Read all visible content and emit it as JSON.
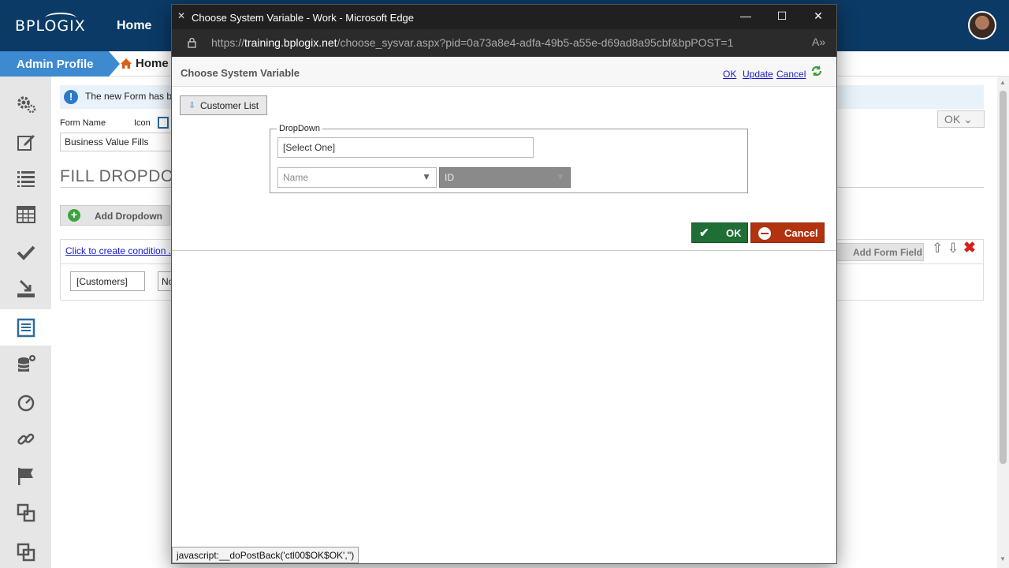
{
  "app": {
    "logo": "BPLOGIX",
    "top_nav": {
      "home": "Home"
    },
    "breadcrumb": {
      "admin": "Admin Profile",
      "home": "Home"
    },
    "info_message": "The new Form has b",
    "ok_dropdown": "OK",
    "form_name_label": "Form Name",
    "icon_label": "Icon",
    "form_name_value": "Business Value Fills",
    "heading": "FILL DROPDOW",
    "add_dropdown": "Add Dropdown",
    "condition_link": "Click to create condition ...",
    "customers_value": "[Customers]",
    "no_value": "No",
    "add_form_field": "Add Form Field"
  },
  "sidebar": {
    "items": [
      {
        "icon": "gears-icon"
      },
      {
        "icon": "edit-icon"
      },
      {
        "icon": "list-icon"
      },
      {
        "icon": "table-icon"
      },
      {
        "icon": "check-icon"
      },
      {
        "icon": "install-icon"
      },
      {
        "icon": "form-list-icon",
        "active": true
      },
      {
        "icon": "database-add-icon"
      },
      {
        "icon": "speedometer-icon"
      },
      {
        "icon": "link-icon"
      },
      {
        "icon": "flag-icon"
      },
      {
        "icon": "copy-icon"
      },
      {
        "icon": "stack-icon"
      }
    ]
  },
  "popup": {
    "window_title": "Choose System Variable - Work - Microsoft Edge",
    "url_prefix": "https://",
    "url_host": "training.bplogix.net",
    "url_path": "/choose_sysvar.aspx?pid=0a73a8e4-adfa-49b5-a55e-d69ad8a95cbf&bpPOST=1",
    "dialog_title": "Choose System Variable",
    "header_links": {
      "ok": "OK",
      "update": "Update",
      "cancel": "Cancel"
    },
    "customer_list_button": "Customer List",
    "dropdown_legend": "DropDown",
    "select_one_value": "[Select One]",
    "name_select_value": "Name",
    "id_select_value": "ID",
    "ok_button": "OK",
    "cancel_button": "Cancel",
    "status_text": "javascript:__doPostBack('ctl00$OK$OK','')"
  },
  "colors": {
    "topbar": "#0b3a66",
    "admin_tab": "#3d8ad0",
    "ok_green": "#1f6e35",
    "cancel_red": "#b3320f"
  }
}
